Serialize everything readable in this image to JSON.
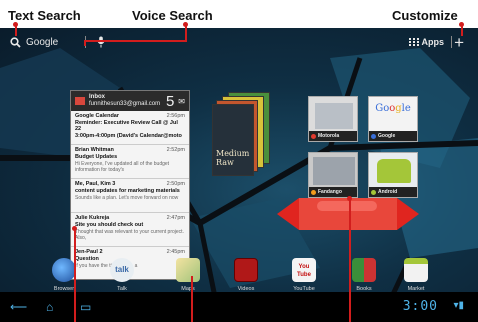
{
  "callouts": {
    "text_search": "Text Search",
    "voice_search": "Voice Search",
    "customize": "Customize"
  },
  "topbar": {
    "google_label": "Google",
    "apps_label": "Apps",
    "plus_glyph": "+"
  },
  "email_widget": {
    "title": "Inbox",
    "account": "funnithesun33@gmail.com",
    "count": "5",
    "messages": [
      {
        "from": "Google Calendar",
        "time": "2:56pm",
        "subject": "Reminder: Executive Review Call @ Jul 22",
        "snippet": "3:00pm-4:00pm (David's Calendar@moto"
      },
      {
        "from": "Brian Whitman",
        "time": "2:52pm",
        "subject": "Budget Updates",
        "snippet": "Hi Everyone, I've updated all of the budget information for today's"
      },
      {
        "from": "Me, Paul, Kim 3",
        "time": "2:50pm",
        "subject": "content updates for marketing materials",
        "snippet": "Sounds like a plan. Let's move forward on now"
      },
      {
        "from": "Julie Kukreja",
        "time": "2:47pm",
        "subject": "Site you should check out",
        "snippet": "Thought that was relevant to your current project. Also,"
      },
      {
        "from": "Jen-Paul 2",
        "time": "2:45pm",
        "subject": "Question",
        "snippet": "If you have the time today, a"
      }
    ]
  },
  "books_widget": {
    "cover_title": "Medium Raw"
  },
  "bookmarks": [
    {
      "label": "Motorola"
    },
    {
      "label": "Google"
    },
    {
      "label": "Fandango"
    },
    {
      "label": "Android"
    }
  ],
  "dock": [
    {
      "label": "Browser"
    },
    {
      "label": "Talk",
      "glyph": "talk"
    },
    {
      "label": "Maps"
    },
    {
      "label": "Videos"
    },
    {
      "label": "YouTube",
      "glyph": "You Tube"
    },
    {
      "label": "Books"
    },
    {
      "label": "Market"
    }
  ],
  "sysbar": {
    "time": "3:00",
    "back_glyph": "⟵",
    "home_glyph": "⌂",
    "recent_glyph": "▭",
    "signal_glyph": "▾▮"
  },
  "colors": {
    "callout_line": "#d21d1d",
    "clock": "#4fb3e8",
    "drag_arrow": "#e0251f"
  }
}
